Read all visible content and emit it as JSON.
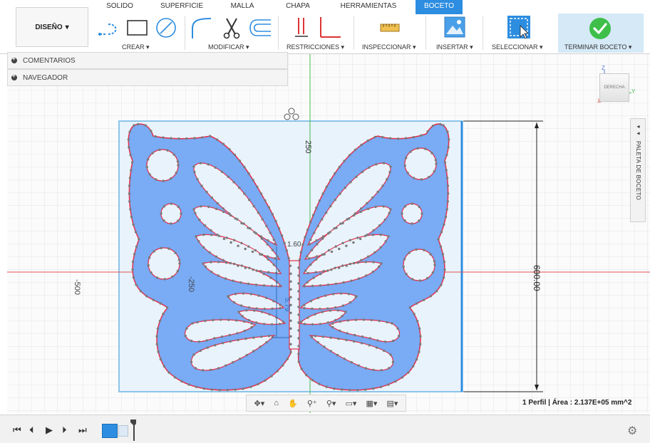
{
  "tabs": [
    "SOLIDO",
    "SUPERFICIE",
    "MALLA",
    "CHAPA",
    "HERRAMIENTAS",
    "BOCETO"
  ],
  "active_tab": "BOCETO",
  "workspace": {
    "label": "DISEÑO",
    "chevron": "▾"
  },
  "groups": {
    "crear": "CREAR ▾",
    "modificar": "MODIFICAR ▾",
    "restricciones": "RESTRICCIONES ▾",
    "inspeccionar": "INSPECCIONAR ▾",
    "insertar": "INSERTAR ▾",
    "seleccionar": "SELECCIONAR ▾",
    "terminar": "TERMINAR BOCETO ▾"
  },
  "browser": {
    "comments": "COMENTARIOS",
    "navigator": "NAVEGADOR"
  },
  "viewcube": {
    "face": "DERECHA",
    "axis_z": "Z",
    "axis_y": "Y",
    "axis_x": "X"
  },
  "palette": {
    "label": "PALETA DE BOCETO",
    "collapse": "◂◂"
  },
  "dimensions": {
    "height": "600.00",
    "axis_250_top": "250",
    "axis_neg250": "-250",
    "axis_neg500": "-500",
    "center_160": "1.60",
    "inner_dim": "5.79"
  },
  "status": "1 Perfil | Área : 2.137E+05 mm^2",
  "colors": {
    "accent": "#2d8de0",
    "profile_fill": "#7aabf5",
    "outline": "#e0304a",
    "sketch_bg": "#e9f3fb",
    "sketch_border": "#8cc4ea",
    "axis_green": "#48b84d",
    "axis_red": "#e05050",
    "finish_check": "#3ebf4a"
  }
}
